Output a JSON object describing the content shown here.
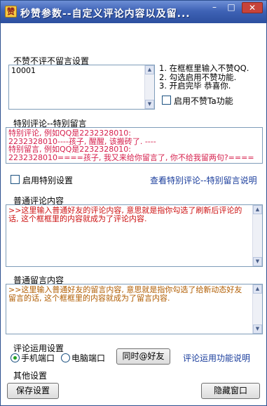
{
  "window": {
    "title": "秒赞参数--自定义评论内容以及留...",
    "min_glyph": "–",
    "max_glyph": "□",
    "close_glyph": "✕"
  },
  "no_comment": {
    "label": "不赞不评不留言设置",
    "value": "10001",
    "instructions": [
      "1. 在框框里输入不赞QQ.",
      "2. 勾选启用不赞功能.",
      "3. 开启完毕 恭喜你."
    ],
    "checkbox_label": "启用不赞Ta功能"
  },
  "special": {
    "label": "特别评论--特别留言",
    "lines": [
      "特别评论, 例如QQ是2232328010:",
      "2232328010----孩子, 醒醒, 该搬砖了. ----",
      "特别留言, 例如QQ是2232328010:",
      "2232328010====孩子, 我又来给你留言了, 你不给我留两句?===="
    ],
    "checkbox_label": "启用特别设置",
    "link": "查看特别评论--特别留言说明"
  },
  "comment": {
    "label": "普通评论内容",
    "text": ">>这里输入普通好友的评论内容, 意思就是指你勾选了刷新后评论的话, 这个框框里的内容就成为了评论内容."
  },
  "message": {
    "label": "普通留言内容",
    "text": ">>这里输入普通好友的留言内容, 意思就是指你勾选了给新动态好友留言的话, 这个框框里的内容就成为了留言内容."
  },
  "usage": {
    "label": "评论运用设置",
    "radio_mobile": "手机端口",
    "radio_pc": "电脑端口",
    "at_button": "同时@好友",
    "link": "评论运用功能说明"
  },
  "other": {
    "label": "其他设置",
    "save_button": "保存设置",
    "hide_button": "隐藏窗口"
  }
}
